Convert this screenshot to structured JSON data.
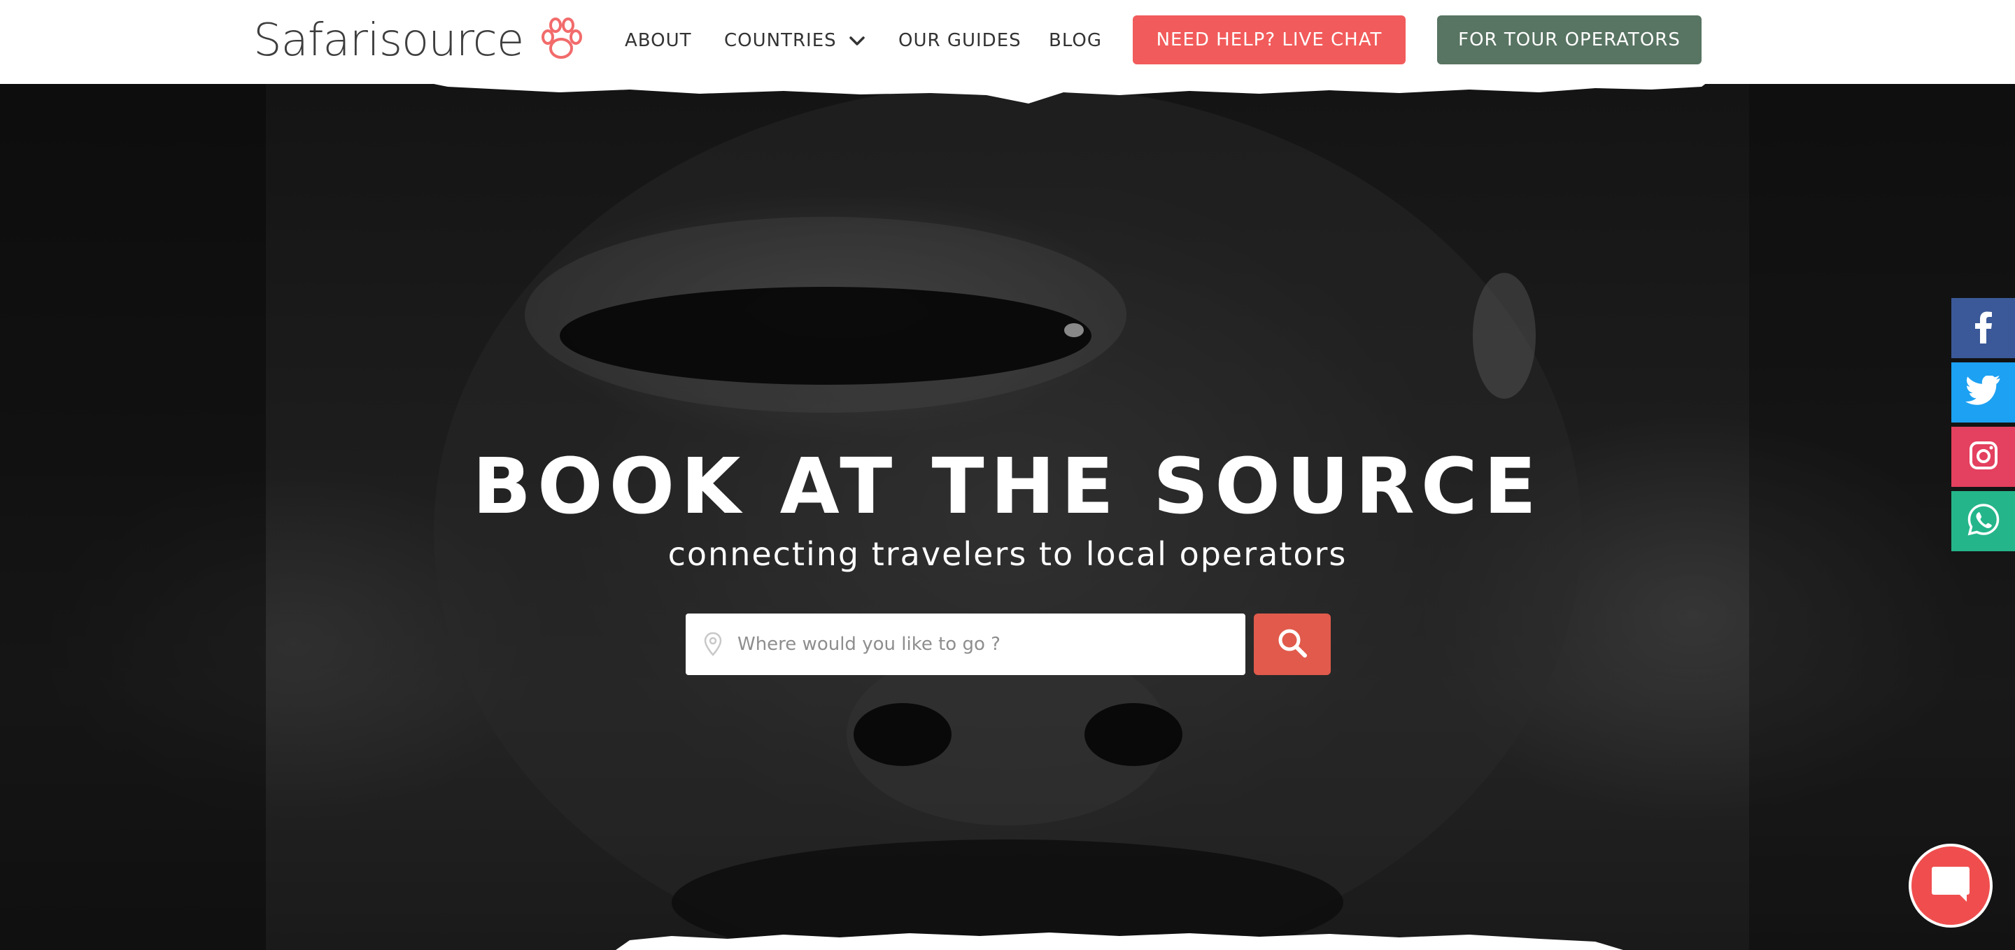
{
  "brand": {
    "name": "Safarisource",
    "paw_color": "#f26b6b"
  },
  "nav": {
    "items": [
      {
        "label": "ABOUT"
      },
      {
        "label": "COUNTRIES"
      },
      {
        "label": "OUR GUIDES"
      },
      {
        "label": "BLOG"
      }
    ],
    "cta_chat": {
      "label": "NEED HELP? LIVE CHAT",
      "color": "#f25b5b"
    },
    "cta_operators": {
      "label": "FOR TOUR OPERATORS",
      "color": "#587462"
    }
  },
  "hero": {
    "title": "BOOK AT THE SOURCE",
    "subtitle": "connecting travelers to local operators",
    "search": {
      "placeholder": "Where would you like to go ?",
      "value": "",
      "button_color": "#e15a4b"
    }
  },
  "social": [
    {
      "name": "facebook",
      "icon": "facebook-icon",
      "color": "#3b5998"
    },
    {
      "name": "twitter",
      "icon": "twitter-icon",
      "color": "#1da1f2"
    },
    {
      "name": "instagram",
      "icon": "instagram-icon",
      "color": "#e4405f"
    },
    {
      "name": "whatsapp",
      "icon": "whatsapp-icon",
      "color": "#25b58a"
    }
  ],
  "chat_widget": {
    "icon": "chat-bubble-icon",
    "color": "#f04e4e"
  }
}
